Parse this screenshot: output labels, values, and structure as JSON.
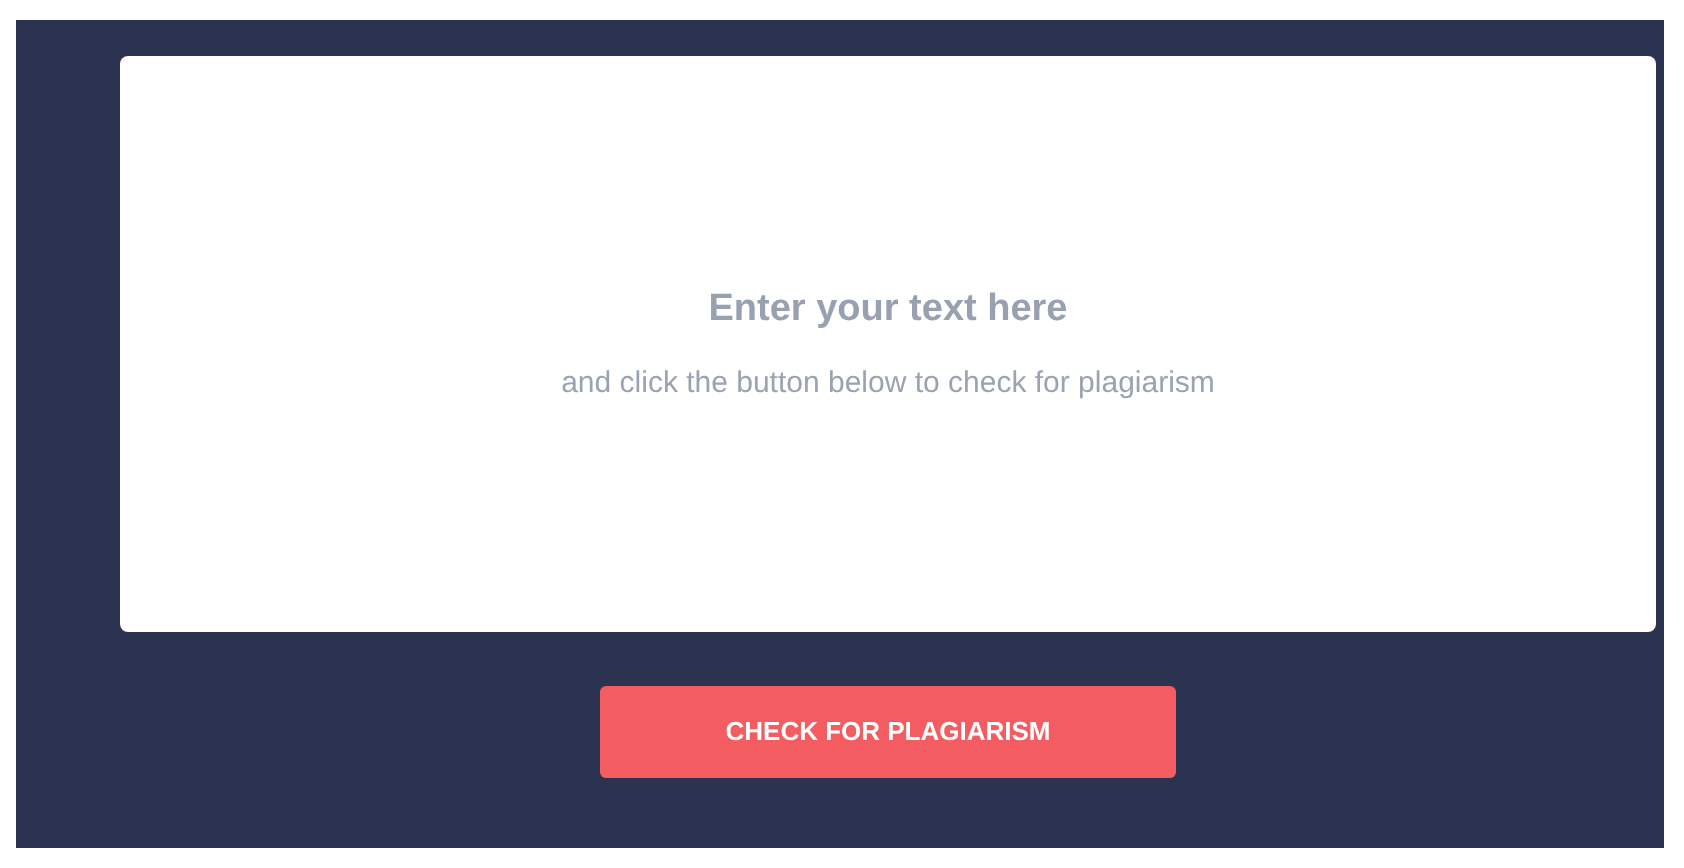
{
  "editor": {
    "placeholder": [
      "Enter your text here",
      "and click the button below to check for plagiarism"
    ]
  },
  "button": {
    "label": "CHECK FOR PLAGIARISM"
  }
}
